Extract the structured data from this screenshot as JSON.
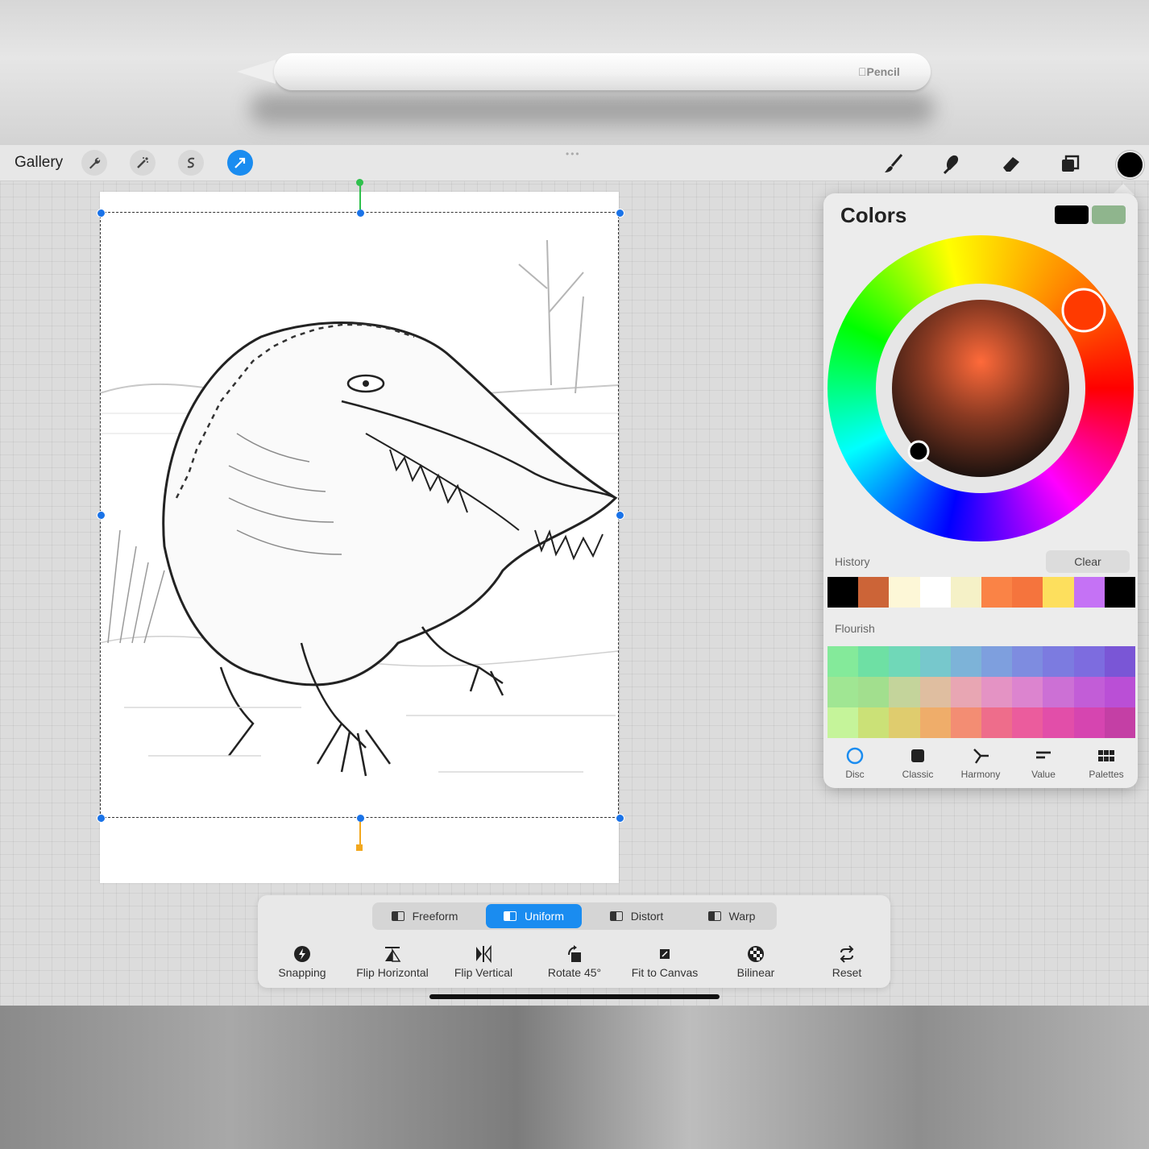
{
  "device": {
    "pencil_brand": "Pencil"
  },
  "toolbar": {
    "gallery_label": "Gallery",
    "left_tools": [
      "wrench-icon",
      "magic-wand-icon",
      "selection-s-icon",
      "transform-arrow-icon"
    ],
    "right_tools": [
      "brush-icon",
      "smudge-icon",
      "eraser-icon",
      "layers-icon"
    ],
    "current_color": "#000000",
    "accent": "#1a8cf0"
  },
  "colors_panel": {
    "title": "Colors",
    "primary_swatch": "#000000",
    "secondary_swatch": "#8fb58d",
    "history_label": "History",
    "clear_label": "Clear",
    "history": [
      "#000000",
      "#cc6437",
      "#fdf7d7",
      "#ffffff",
      "#f5f1c7",
      "#fa8346",
      "#f5743d",
      "#fddf5d",
      "#c572f5",
      "#000000"
    ],
    "flourish_label": "Flourish",
    "flourish": [
      [
        "#84ea9a",
        "#6ee0a4",
        "#70d8b8",
        "#77c8cc",
        "#7db3d8",
        "#7e9fde",
        "#7e8ce0",
        "#7c7be0",
        "#7d6cdf",
        "#7a56d6"
      ],
      [
        "#a0e693",
        "#a2df8e",
        "#c4d49b",
        "#dfbea0",
        "#e8a6b3",
        "#e493c4",
        "#dc84cf",
        "#cc70d5",
        "#c25dd7",
        "#ba4fd6"
      ],
      [
        "#c5f49a",
        "#cbe177",
        "#dfcc6e",
        "#efad6a",
        "#f38d73",
        "#ee6d8b",
        "#eb5c9d",
        "#e24ea9",
        "#d645b0",
        "#c43fa5"
      ]
    ],
    "modes": [
      {
        "label": "Disc",
        "icon": "disc-icon"
      },
      {
        "label": "Classic",
        "icon": "classic-icon"
      },
      {
        "label": "Harmony",
        "icon": "harmony-icon"
      },
      {
        "label": "Value",
        "icon": "value-icon"
      },
      {
        "label": "Palettes",
        "icon": "palettes-icon"
      }
    ],
    "active_mode": "Disc"
  },
  "transform": {
    "modes": [
      "Freeform",
      "Uniform",
      "Distort",
      "Warp"
    ],
    "active_mode": "Uniform",
    "actions": [
      {
        "label": "Snapping",
        "icon": "snapping-icon"
      },
      {
        "label": "Flip Horizontal",
        "icon": "flip-horizontal-icon"
      },
      {
        "label": "Flip Vertical",
        "icon": "flip-vertical-icon"
      },
      {
        "label": "Rotate 45°",
        "icon": "rotate-icon"
      },
      {
        "label": "Fit to Canvas",
        "icon": "fit-canvas-icon"
      },
      {
        "label": "Bilinear",
        "icon": "bilinear-icon"
      },
      {
        "label": "Reset",
        "icon": "reset-icon"
      }
    ]
  }
}
